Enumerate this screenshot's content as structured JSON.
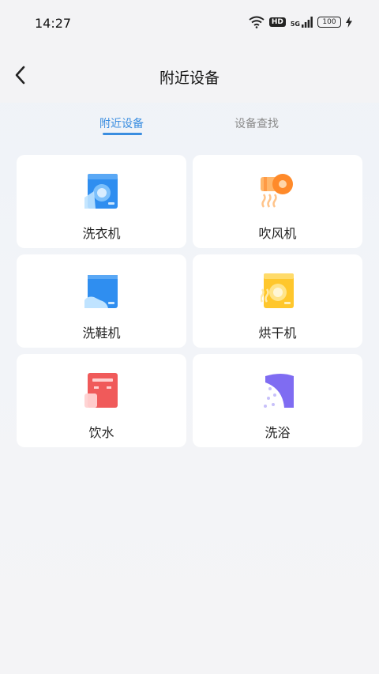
{
  "status_bar": {
    "time": "14:27",
    "network_label": "5G",
    "hd_label": "HD",
    "battery_level": "100"
  },
  "header": {
    "back_icon": "chevron-left-icon",
    "title": "附近设备"
  },
  "tabs": [
    {
      "label": "附近设备",
      "active": true
    },
    {
      "label": "设备查找",
      "active": false
    }
  ],
  "devices": [
    {
      "label": "洗衣机",
      "icon": "washing-machine-icon"
    },
    {
      "label": "吹风机",
      "icon": "hair-dryer-icon"
    },
    {
      "label": "洗鞋机",
      "icon": "shoe-washer-icon"
    },
    {
      "label": "烘干机",
      "icon": "dryer-icon"
    },
    {
      "label": "饮水",
      "icon": "water-dispenser-icon"
    },
    {
      "label": "洗浴",
      "icon": "shower-icon"
    }
  ],
  "colors": {
    "accent": "#3a8de0",
    "card_background": "#ffffff"
  }
}
